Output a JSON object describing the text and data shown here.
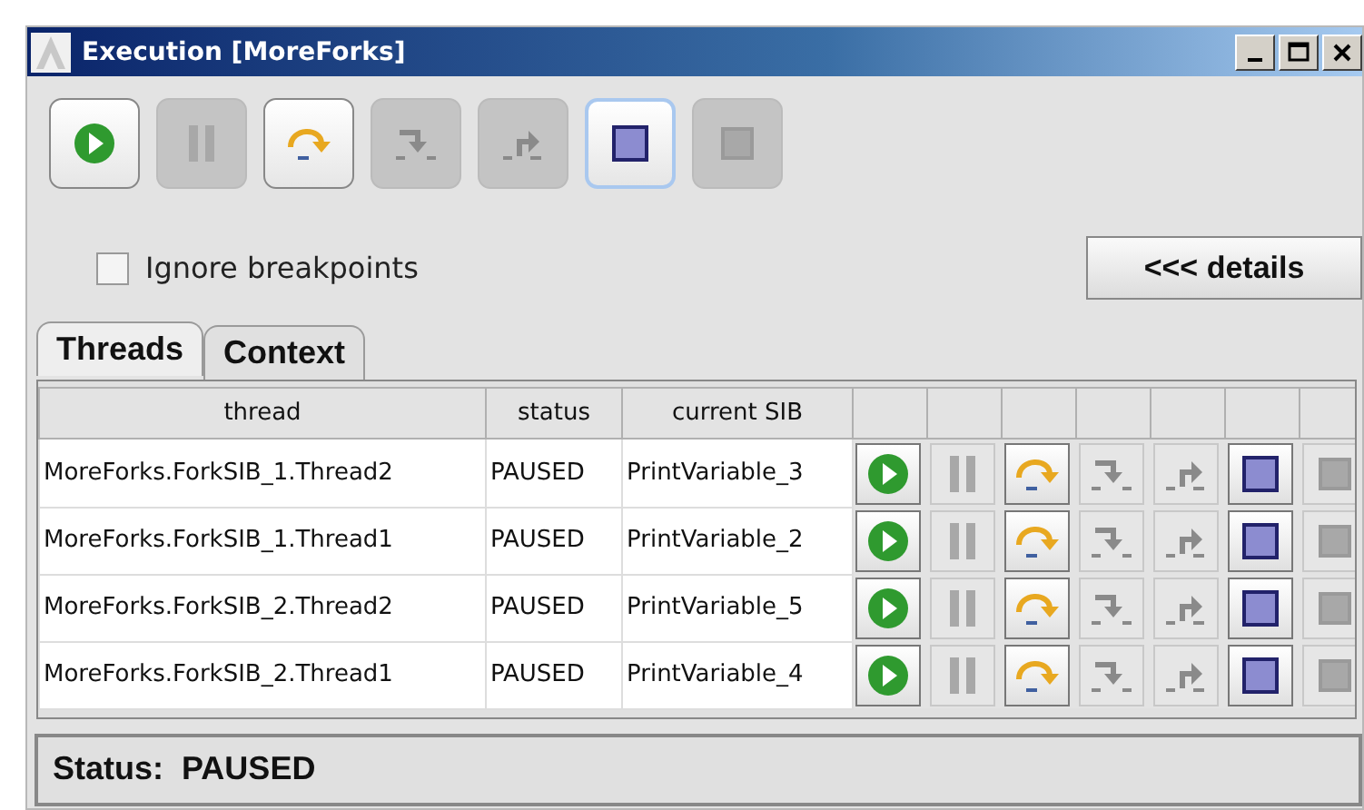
{
  "window": {
    "title": "Execution [MoreForks]"
  },
  "toolbar": [
    {
      "kind": "run",
      "disabled": false,
      "focused": false
    },
    {
      "kind": "pause",
      "disabled": true,
      "focused": false
    },
    {
      "kind": "step_over",
      "disabled": false,
      "focused": false
    },
    {
      "kind": "step_into",
      "disabled": true,
      "focused": false
    },
    {
      "kind": "step_out",
      "disabled": true,
      "focused": false
    },
    {
      "kind": "suspend",
      "disabled": false,
      "focused": true
    },
    {
      "kind": "terminate",
      "disabled": true,
      "focused": false
    }
  ],
  "ignore_breakpoints": {
    "label": "Ignore breakpoints",
    "checked": false
  },
  "details_button": "<<< details",
  "tabs": [
    {
      "label": "Threads",
      "selected": true
    },
    {
      "label": "Context",
      "selected": false
    }
  ],
  "table": {
    "columns": [
      "thread",
      "status",
      "current SIB"
    ],
    "rows": [
      {
        "thread": "MoreForks.ForkSIB_1.Thread2",
        "status": "PAUSED",
        "sib": "PrintVariable_3",
        "controls": [
          {
            "kind": "run",
            "disabled": false
          },
          {
            "kind": "pause",
            "disabled": true
          },
          {
            "kind": "step_over",
            "disabled": false
          },
          {
            "kind": "step_into",
            "disabled": true
          },
          {
            "kind": "step_out",
            "disabled": true
          },
          {
            "kind": "suspend",
            "disabled": false
          },
          {
            "kind": "terminate",
            "disabled": true
          }
        ]
      },
      {
        "thread": "MoreForks.ForkSIB_1.Thread1",
        "status": "PAUSED",
        "sib": "PrintVariable_2",
        "controls": [
          {
            "kind": "run",
            "disabled": false
          },
          {
            "kind": "pause",
            "disabled": true
          },
          {
            "kind": "step_over",
            "disabled": false
          },
          {
            "kind": "step_into",
            "disabled": true
          },
          {
            "kind": "step_out",
            "disabled": true
          },
          {
            "kind": "suspend",
            "disabled": false
          },
          {
            "kind": "terminate",
            "disabled": true
          }
        ]
      },
      {
        "thread": "MoreForks.ForkSIB_2.Thread2",
        "status": "PAUSED",
        "sib": "PrintVariable_5",
        "controls": [
          {
            "kind": "run",
            "disabled": false
          },
          {
            "kind": "pause",
            "disabled": true
          },
          {
            "kind": "step_over",
            "disabled": false
          },
          {
            "kind": "step_into",
            "disabled": true
          },
          {
            "kind": "step_out",
            "disabled": true
          },
          {
            "kind": "suspend",
            "disabled": false
          },
          {
            "kind": "terminate",
            "disabled": true
          }
        ]
      },
      {
        "thread": "MoreForks.ForkSIB_2.Thread1",
        "status": "PAUSED",
        "sib": "PrintVariable_4",
        "controls": [
          {
            "kind": "run",
            "disabled": false
          },
          {
            "kind": "pause",
            "disabled": true
          },
          {
            "kind": "step_over",
            "disabled": false
          },
          {
            "kind": "step_into",
            "disabled": true
          },
          {
            "kind": "step_out",
            "disabled": true
          },
          {
            "kind": "suspend",
            "disabled": false
          },
          {
            "kind": "terminate",
            "disabled": true
          }
        ]
      }
    ]
  },
  "status_bar": {
    "label": "Status:",
    "value": "PAUSED"
  }
}
